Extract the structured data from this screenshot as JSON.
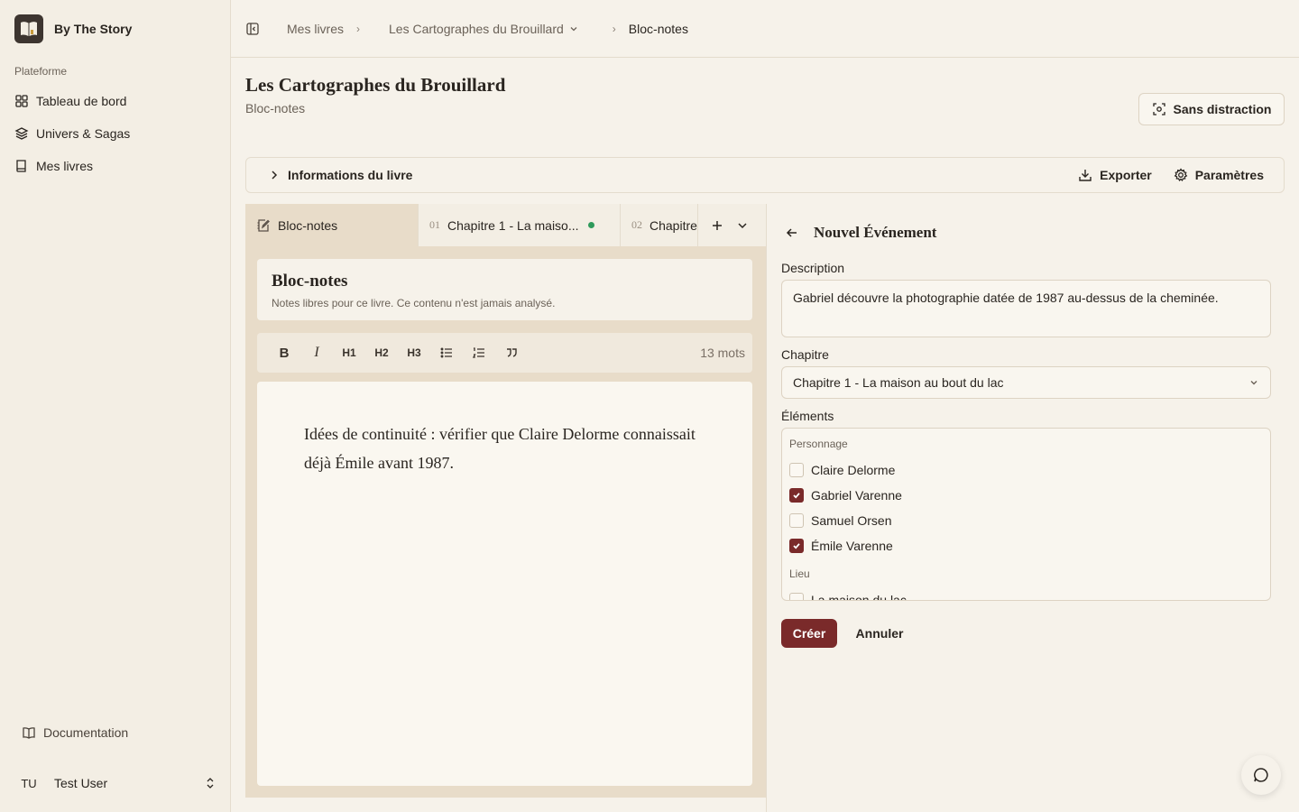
{
  "app": {
    "name": "By The Story"
  },
  "sidebar": {
    "section_label": "Plateforme",
    "items": [
      {
        "label": "Tableau de bord",
        "icon": "grid-icon"
      },
      {
        "label": "Univers & Sagas",
        "icon": "layers-icon"
      },
      {
        "label": "Mes livres",
        "icon": "book-icon"
      }
    ],
    "documentation": "Documentation",
    "user": {
      "initials": "TU",
      "name": "Test User"
    }
  },
  "breadcrumb": {
    "items": [
      "Mes livres",
      "Les Cartographes du Brouillard",
      "Bloc-notes"
    ]
  },
  "page": {
    "title": "Les Cartographes du Brouillard",
    "subtitle": "Bloc-notes",
    "focus_button": "Sans distraction"
  },
  "infobar": {
    "title": "Informations du livre",
    "export": "Exporter",
    "settings": "Paramètres"
  },
  "tabs": [
    {
      "label": "Bloc-notes"
    },
    {
      "num": "01",
      "label": "Chapitre 1 - La maiso..."
    },
    {
      "num": "02",
      "label": "Chapitre"
    }
  ],
  "notebook": {
    "title": "Bloc-notes",
    "subtitle": "Notes libres pour ce livre. Ce contenu n'est jamais analysé.",
    "word_count": "13 mots",
    "toolbar": {
      "bold": "B",
      "italic": "I",
      "h1": "H1",
      "h2": "H2",
      "h3": "H3"
    },
    "content": "Idées de continuité : vérifier que Claire Delorme connaissait déjà Émile avant 1987."
  },
  "event_panel": {
    "title": "Nouvel Événement",
    "description_label": "Description",
    "description_value": "Gabriel découvre la photographie datée de 1987 au-dessus de la cheminée.",
    "chapter_label": "Chapitre",
    "chapter_value": "Chapitre 1 - La maison au bout du lac",
    "elements_label": "Éléments",
    "groups": [
      {
        "name": "Personnage",
        "items": [
          {
            "label": "Claire Delorme",
            "checked": false
          },
          {
            "label": "Gabriel Varenne",
            "checked": true
          },
          {
            "label": "Samuel Orsen",
            "checked": false
          },
          {
            "label": "Émile Varenne",
            "checked": true
          }
        ]
      },
      {
        "name": "Lieu",
        "items": [
          {
            "label": "La maison du lac",
            "checked": false
          }
        ]
      }
    ],
    "create": "Créer",
    "cancel": "Annuler"
  },
  "colors": {
    "accent": "#7a2a2a",
    "status_dot": "#2f9a5b",
    "background": "#f6f2ea"
  }
}
